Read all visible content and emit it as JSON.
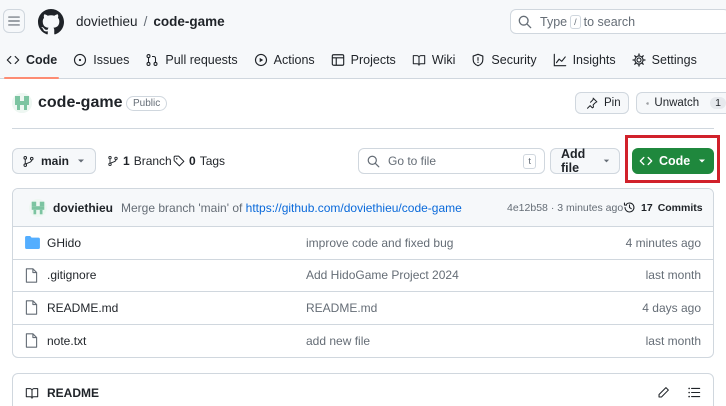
{
  "header": {
    "owner": "doviethieu",
    "separator": "/",
    "repo": "code-game",
    "search": {
      "prefix": "Type",
      "key": "/",
      "suffix": "to search"
    }
  },
  "tabs": [
    {
      "label": "Code",
      "icon": "code-icon",
      "active": true
    },
    {
      "label": "Issues",
      "icon": "issue-opened-icon"
    },
    {
      "label": "Pull requests",
      "icon": "git-pull-request-icon"
    },
    {
      "label": "Actions",
      "icon": "play-icon"
    },
    {
      "label": "Projects",
      "icon": "table-icon"
    },
    {
      "label": "Wiki",
      "icon": "book-icon"
    },
    {
      "label": "Security",
      "icon": "shield-icon"
    },
    {
      "label": "Insights",
      "icon": "graph-icon"
    },
    {
      "label": "Settings",
      "icon": "gear-icon"
    }
  ],
  "repo": {
    "title": "code-game",
    "visibility": "Public",
    "pin_label": "Pin",
    "unwatch_label": "Unwatch",
    "watch_count": "1"
  },
  "toolbar": {
    "branch": "main",
    "branch_count": "1",
    "branch_label": "Branch",
    "tag_count": "0",
    "tag_label": "Tags",
    "goto_placeholder": "Go to file",
    "goto_key": "t",
    "add_file_label": "Add file",
    "code_label": "Code"
  },
  "latest_commit": {
    "author": "doviethieu",
    "message_prefix": "Merge branch 'main' of",
    "message_link": "https://github.com/doviethieu/code-game",
    "hash": "4e12b58",
    "dot": "·",
    "time": "3 minutes ago",
    "commits_count": "17",
    "commits_label": "Commits"
  },
  "files": [
    {
      "name": "GHido",
      "type": "folder",
      "message": "improve code and fixed bug",
      "date": "4 minutes ago"
    },
    {
      "name": ".gitignore",
      "type": "file",
      "message": "Add HidoGame Project 2024",
      "date": "last month"
    },
    {
      "name": "README.md",
      "type": "file",
      "message": "README.md",
      "date": "4 days ago"
    },
    {
      "name": "note.txt",
      "type": "file",
      "message": "add new file",
      "date": "last month"
    }
  ],
  "readme": {
    "label": "README"
  },
  "colors": {
    "primary_button": "#1f883d",
    "link": "#0969da",
    "highlight_outline": "#d1212b",
    "active_tab_underline": "#fd8c73",
    "folder": "#54aeff"
  }
}
